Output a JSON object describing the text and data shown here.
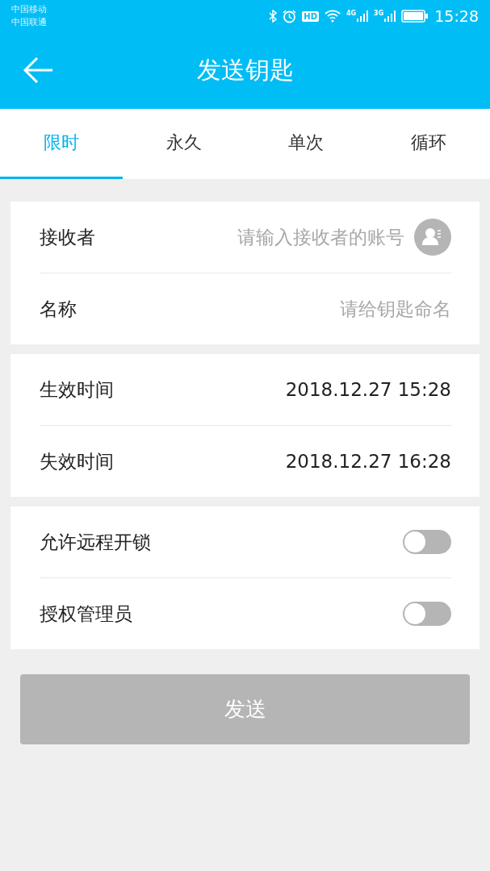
{
  "status_bar": {
    "carriers": [
      "中国移动",
      "中国联通"
    ],
    "hd": "HD",
    "network_1": "4G",
    "network_2": "3G",
    "time": "15:28"
  },
  "header": {
    "title": "发送钥匙"
  },
  "tabs": [
    {
      "label": "限时",
      "selected": true
    },
    {
      "label": "永久",
      "selected": false
    },
    {
      "label": "单次",
      "selected": false
    },
    {
      "label": "循环",
      "selected": false
    }
  ],
  "sections": [
    {
      "rows": [
        {
          "kind": "contact-input",
          "label": "接收者",
          "placeholder": "请输入接收者的账号"
        },
        {
          "kind": "input",
          "label": "名称",
          "placeholder": "请给钥匙命名"
        }
      ]
    },
    {
      "rows": [
        {
          "kind": "value",
          "label": "生效时间",
          "value": "2018.12.27 15:28"
        },
        {
          "kind": "value",
          "label": "失效时间",
          "value": "2018.12.27 16:28"
        }
      ]
    },
    {
      "rows": [
        {
          "kind": "toggle",
          "label": "允许远程开锁",
          "on": false
        },
        {
          "kind": "toggle",
          "label": "授权管理员",
          "on": false
        }
      ]
    }
  ],
  "send_button": {
    "label": "发送",
    "disabled": true
  }
}
